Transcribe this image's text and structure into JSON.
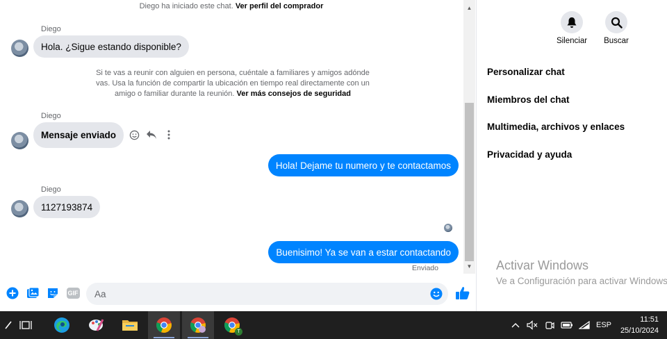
{
  "chat": {
    "started_notice": "Diego ha iniciado este chat.",
    "view_profile_link": "Ver perfil del comprador",
    "messages": [
      {
        "sender": "Diego",
        "text": "Hola. ¿Sigue estando disponible?"
      },
      {
        "sender": "Diego",
        "text": "Mensaje enviado"
      },
      {
        "text": "Hola! Dejame tu numero y te contactamos"
      },
      {
        "sender": "Diego",
        "text": "1127193874"
      },
      {
        "text": "Buenisimo! Ya se van a estar contactando"
      }
    ],
    "safety_notice": "Si te vas a reunir con alguien en persona, cuéntale a familiares y amigos adónde vas. Usa la función de compartir la ubicación en tiempo real directamente con un amigo o familiar durante la reunión.",
    "safety_link": "Ver más consejos de seguridad",
    "status": "Enviado"
  },
  "composer": {
    "placeholder": "Aa",
    "gif_label": "GIF"
  },
  "right_panel": {
    "mute_label": "Silenciar",
    "search_label": "Buscar",
    "items": [
      "Personalizar chat",
      "Miembros del chat",
      "Multimedia, archivos y enlaces",
      "Privacidad y ayuda"
    ]
  },
  "watermark": {
    "title": "Activar Windows",
    "subtitle": "Ve a Configuración para activar Windows."
  },
  "taskbar": {
    "language": "ESP",
    "time": "11:51",
    "date": "25/10/2024",
    "chrome_badge": "T"
  },
  "colors": {
    "outgoing_bubble": "#0084ff",
    "incoming_bubble": "#e4e6eb",
    "taskbar": "#1f1f1f"
  }
}
